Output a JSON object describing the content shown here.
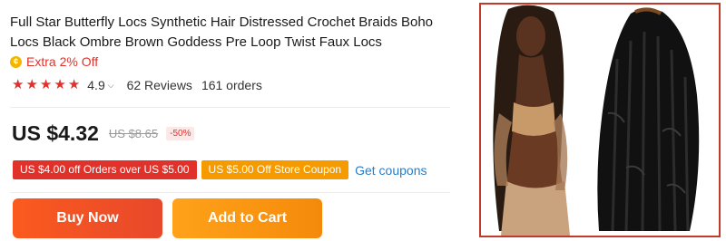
{
  "product": {
    "title": "Full Star Butterfly Locs Synthetic Hair Distressed Crochet Braids Boho Locs Black Ombre Brown Goddess Pre Loop Twist Faux Locs",
    "extra_offer": "Extra 2% Off"
  },
  "rating": {
    "stars": 5,
    "score": "4.9",
    "reviews": "62 Reviews",
    "orders": "161 orders"
  },
  "price": {
    "current": "US $4.32",
    "original": "US $8.65",
    "discount": "-50%"
  },
  "coupons": [
    {
      "label": "US $4.00 off Orders over US $5.00",
      "color": "#e0322b"
    },
    {
      "label": "US $5.00 Off Store Coupon",
      "color": "#f59b00"
    }
  ],
  "get_coupons": "Get coupons",
  "buttons": {
    "buy_now": "Buy Now",
    "add_to_cart": "Add to Cart"
  },
  "colors": {
    "accent_red": "#e0322b",
    "accent_orange": "#f59b00",
    "link_blue": "#2a7cc7",
    "frame_border": "#c0392b"
  }
}
